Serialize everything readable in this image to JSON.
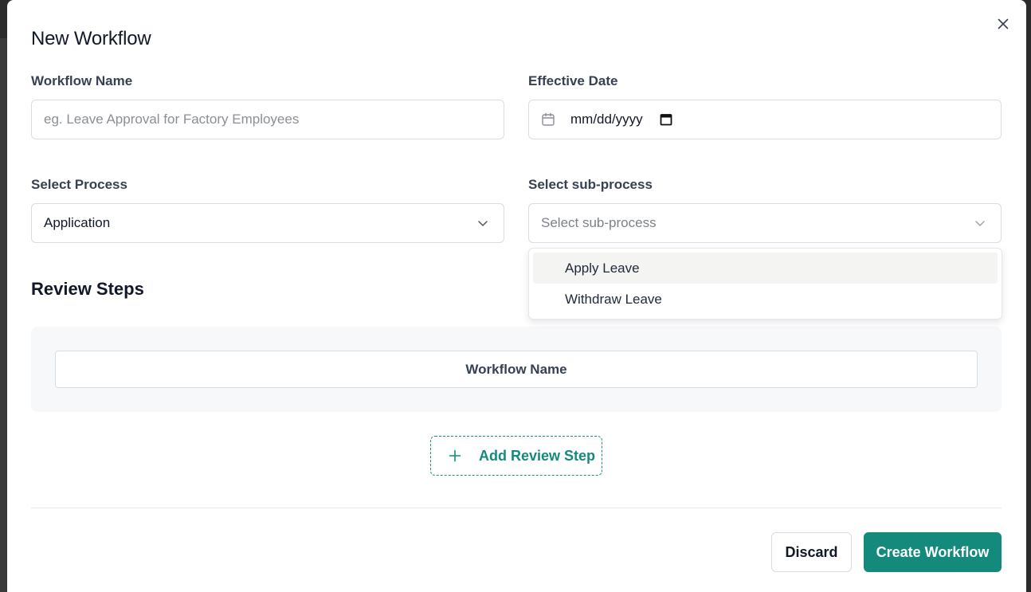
{
  "modal": {
    "title": "New Workflow"
  },
  "form": {
    "workflow_name": {
      "label": "Workflow Name",
      "placeholder": "eg. Leave Approval for Factory Employees",
      "value": ""
    },
    "effective_date": {
      "label": "Effective Date",
      "value_text": "mm/dd/yyyy"
    },
    "process": {
      "label": "Select Process",
      "selected": "Application"
    },
    "sub_process": {
      "label": "Select sub-process",
      "placeholder": "Select sub-process",
      "options": [
        "Apply Leave",
        "Withdraw Leave"
      ],
      "highlighted_index": 0
    }
  },
  "review_steps": {
    "title": "Review Steps",
    "column_header": "Workflow Name",
    "add_button_label": "Add Review Step"
  },
  "footer": {
    "discard_label": "Discard",
    "create_label": "Create Workflow"
  },
  "colors": {
    "accent": "#138a7b",
    "border": "#d8dde3",
    "panel_bg": "#f7f8fa"
  },
  "icons": {
    "close": "close-icon",
    "date": "calendar-icon",
    "chevron": "chevron-down-icon",
    "add": "plus-icon"
  }
}
